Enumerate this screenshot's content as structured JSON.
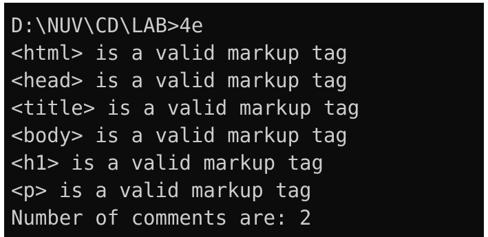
{
  "terminal": {
    "background": "#0c0c0c",
    "foreground": "#cccccc",
    "lines": [
      "D:\\NUV\\CD\\LAB>4e",
      "<html> is a valid markup tag",
      "<head> is a valid markup tag",
      "<title> is a valid markup tag",
      "<body> is a valid markup tag",
      "<h1> is a valid markup tag",
      "<p> is a valid markup tag",
      "Number of comments are: 2"
    ]
  }
}
